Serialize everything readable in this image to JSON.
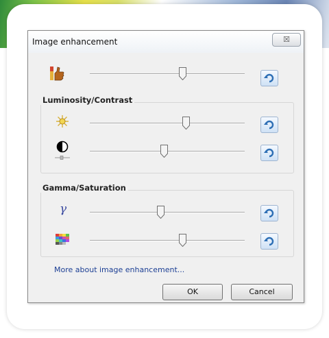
{
  "dialog": {
    "title": "Image enhancement",
    "close_glyph": "☒",
    "close_icon": "close-icon"
  },
  "sliders": {
    "color_balance": {
      "icon": "color-balance-icon",
      "value": 0.6
    },
    "luminosity": {
      "icon": "luminosity-sun-icon",
      "value": 0.62
    },
    "contrast": {
      "icon": "contrast-icon",
      "value": 0.48
    },
    "gamma": {
      "icon": "gamma-icon",
      "glyph": "γ",
      "value": 0.46
    },
    "saturation": {
      "icon": "saturation-grid-icon",
      "value": 0.6
    }
  },
  "groups": {
    "luminosity_contrast": {
      "label": "Luminosity/Contrast"
    },
    "gamma_saturation": {
      "label": "Gamma/Saturation"
    }
  },
  "links": {
    "more_about": "More about image enhancement..."
  },
  "buttons": {
    "ok": "OK",
    "cancel": "Cancel",
    "reset_icon": "undo-icon"
  },
  "colors": {
    "link": "#1c3f94",
    "reset_button_fill": "#cfe1f5",
    "reset_arrow": "#2e6fb5",
    "dialog_background": "#f0f0f0"
  }
}
